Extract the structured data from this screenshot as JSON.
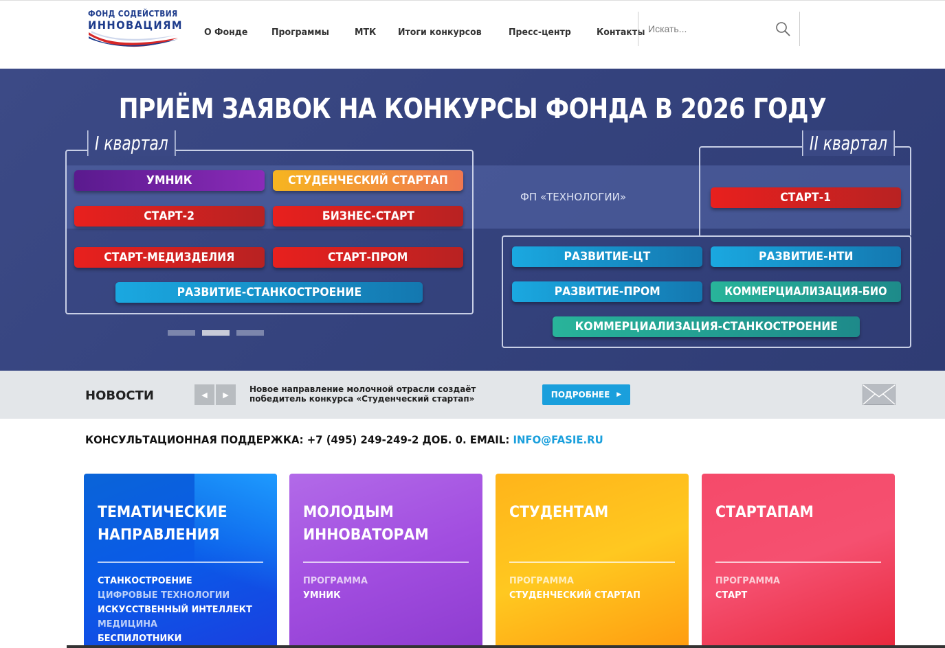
{
  "header": {
    "logo_line1": "ФОНД СОДЕЙСТВИЯ",
    "logo_line2": "ИННОВАЦИЯМ",
    "nav": [
      "О Фонде",
      "Программы",
      "МТК",
      "Итоги конкурсов",
      "Пресс-центр",
      "Контакты"
    ],
    "search_placeholder": "Искать..."
  },
  "banner": {
    "title": "ПРИЁМ ЗАЯВОК НА КОНКУРСЫ ФОНДА В 2026 ГОДУ",
    "q1_label": "I квартал",
    "q2_label": "II квартал",
    "center_label": "ФП «ТЕХНОЛОГИИ»",
    "q1_items": [
      "УМНИК",
      "СТУДЕНЧЕСКИЙ СТАРТАП",
      "СТАРТ-2",
      "БИЗНЕС-СТАРТ",
      "СТАРТ-МЕДИЗДЕЛИЯ",
      "СТАРТ-ПРОМ",
      "РАЗВИТИЕ-СТАНКОСТРОЕНИЕ"
    ],
    "q2_items": [
      "СТАРТ-1",
      "РАЗВИТИЕ-ЦТ",
      "РАЗВИТИЕ-НТИ",
      "РАЗВИТИЕ-ПРОМ",
      "КОММЕРЦИАЛИЗАЦИЯ-БИО",
      "КОММЕРЦИАЛИЗАЦИЯ-СТАНКОСТРОЕНИЕ"
    ],
    "slide_count": 3,
    "active_slide": 2
  },
  "news": {
    "title": "НОВОСТИ",
    "headline": "Новое направление молочной отрасли создаёт победитель конкурса «Студенческий стартап»",
    "more_label": "ПОДРОБНЕЕ"
  },
  "consult": {
    "text": "КОНСУЛЬТАЦИОННАЯ ПОДДЕРЖКА: +7 (495) 249-249-2 ДОБ. 0. EMAIL: ",
    "email": "INFO@FASIE.RU"
  },
  "cards": [
    {
      "title": "ТЕМАТИЧЕСКИЕ НАПРАВЛЕНИЯ",
      "items": [
        "СТАНКОСТРОЕНИЕ",
        "ЦИФРОВЫЕ ТЕХНОЛОГИИ",
        "ИСКУССТВЕННЫЙ ИНТЕЛЛЕКТ",
        "МЕДИЦИНА",
        "БЕСПИЛОТНИКИ"
      ]
    },
    {
      "title": "МОЛОДЫМ ИННОВАТОРАМ",
      "items": [
        "ПРОГРАММА",
        "УМНИК"
      ]
    },
    {
      "title": "СТУДЕНТАМ",
      "items": [
        "ПРОГРАММА",
        "СТУДЕНЧЕСКИЙ СТАРТАП"
      ]
    },
    {
      "title": "СТАРТАПАМ",
      "items": [
        "ПРОГРАММА",
        "СТАРТ"
      ]
    }
  ],
  "colors": {
    "brand_blue": "#1e3c8c",
    "accent": "#1a9fdc",
    "banner_bg": "#3a4884"
  }
}
